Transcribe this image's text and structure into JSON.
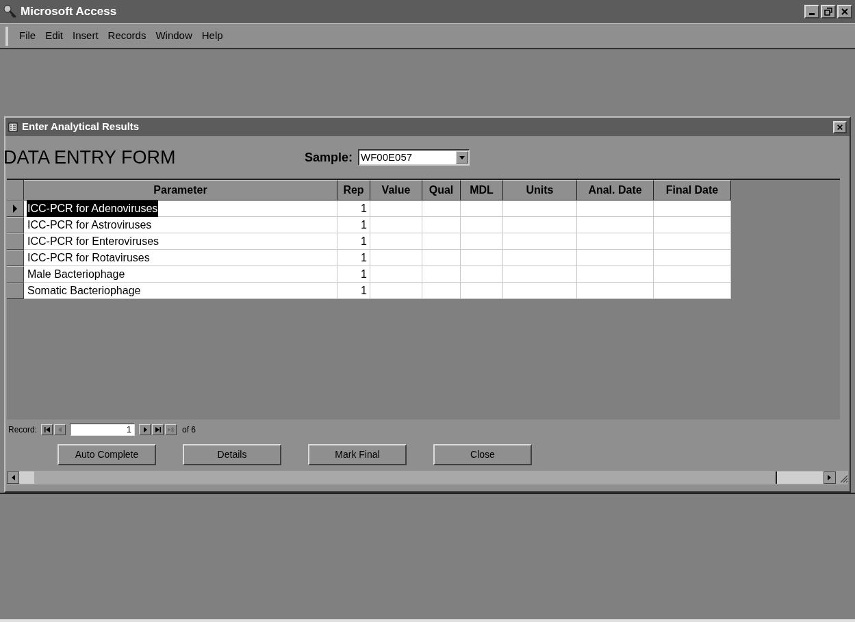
{
  "app_window": {
    "title": "Microsoft Access"
  },
  "menu": [
    {
      "label": "File"
    },
    {
      "label": "Edit"
    },
    {
      "label": "Insert"
    },
    {
      "label": "Records"
    },
    {
      "label": "Window"
    },
    {
      "label": "Help"
    }
  ],
  "form_window": {
    "title": "Enter Analytical Results"
  },
  "form": {
    "heading": "DATA ENTRY FORM",
    "sample_label": "Sample:",
    "sample_value": "WF00E057"
  },
  "table": {
    "columns": [
      "Parameter",
      "Rep",
      "Value",
      "Qual",
      "MDL",
      "Units",
      "Anal. Date",
      "Final Date"
    ],
    "rows": [
      {
        "parameter": "ICC-PCR for Adenoviruses",
        "rep": "1",
        "selected": true
      },
      {
        "parameter": "ICC-PCR for Astroviruses",
        "rep": "1",
        "selected": false
      },
      {
        "parameter": "ICC-PCR for Enteroviruses",
        "rep": "1",
        "selected": false
      },
      {
        "parameter": "ICC-PCR for Rotaviruses",
        "rep": "1",
        "selected": false
      },
      {
        "parameter": "Male Bacteriophage",
        "rep": "1",
        "selected": false
      },
      {
        "parameter": "Somatic Bacteriophage",
        "rep": "1",
        "selected": false
      }
    ]
  },
  "navigator": {
    "label": "Record:",
    "current": "1",
    "total": "of 6",
    "buttons": [
      {
        "kind": "first",
        "disabled": false
      },
      {
        "kind": "prev",
        "disabled": true
      },
      {
        "kind": "next",
        "disabled": false
      },
      {
        "kind": "last",
        "disabled": false
      },
      {
        "kind": "new",
        "disabled": true
      }
    ]
  },
  "buttons": [
    {
      "label": "Auto Complete"
    },
    {
      "label": "Details"
    },
    {
      "label": "Mark Final"
    },
    {
      "label": "Close"
    }
  ]
}
